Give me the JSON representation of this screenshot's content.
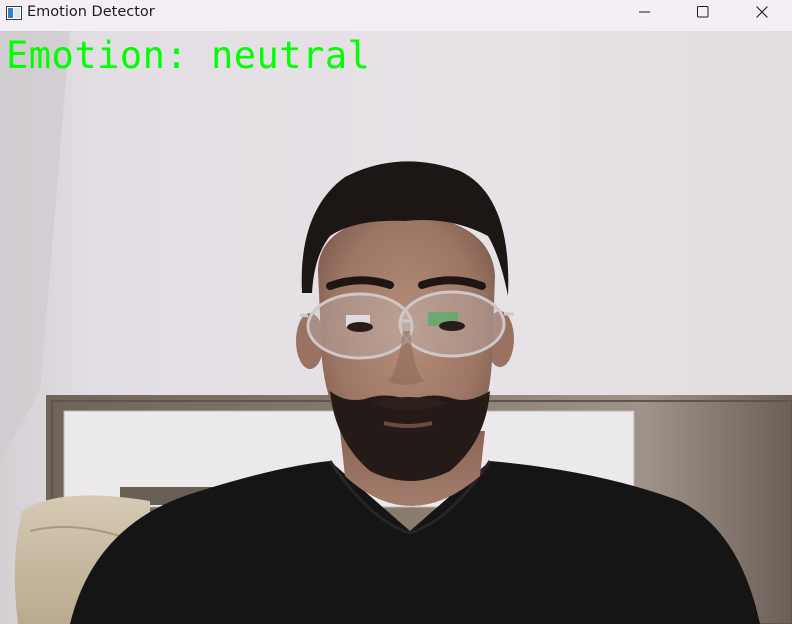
{
  "window": {
    "title": "Emotion Detector",
    "icon": "opencv-window-icon",
    "controls": {
      "minimize": "minimize-icon",
      "maximize": "maximize-icon",
      "close": "close-icon"
    }
  },
  "overlay": {
    "label": "Emotion: neutral",
    "color": "#00ff00"
  },
  "colors": {
    "titlebar": "#f4eef7",
    "wall": "#e4e0e4",
    "shirt": "#161515"
  }
}
